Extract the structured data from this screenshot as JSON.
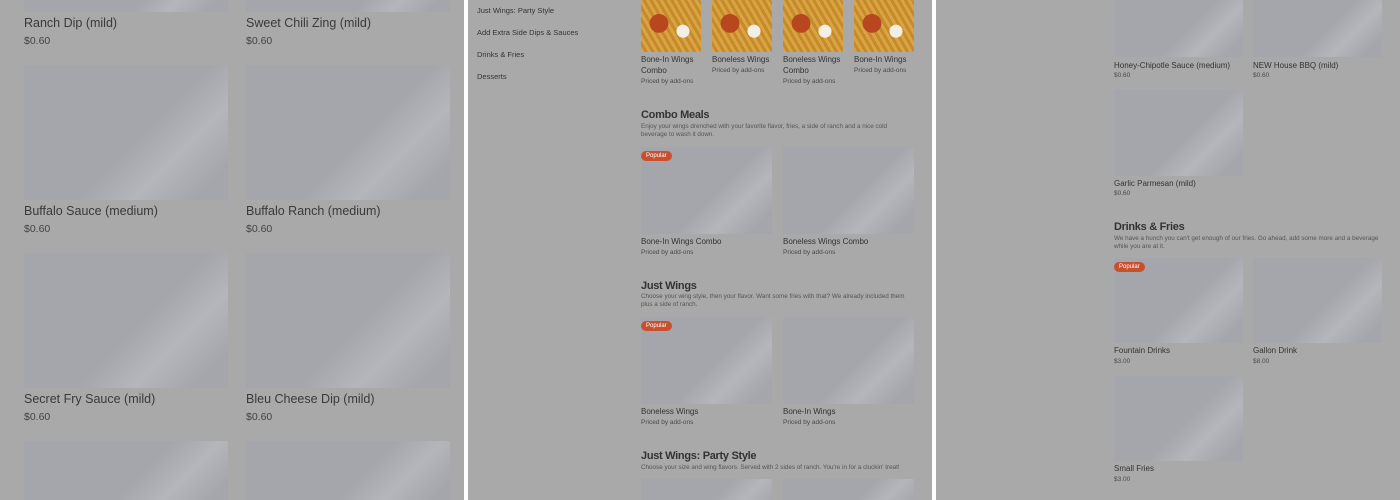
{
  "left": {
    "items": [
      {
        "name": "Ranch Dip (mild)",
        "price": "$0.60"
      },
      {
        "name": "Sweet Chili Zing (mild)",
        "price": "$0.60"
      },
      {
        "name": "Buffalo Sauce (medium)",
        "price": "$0.60"
      },
      {
        "name": "Buffalo Ranch (medium)",
        "price": "$0.60"
      },
      {
        "name": "Secret Fry Sauce (mild)",
        "price": "$0.60"
      },
      {
        "name": "Bleu Cheese Dip (mild)",
        "price": "$0.60"
      }
    ]
  },
  "middle": {
    "nav": [
      "Just Wings: Party Style",
      "Add Extra Side Dips & Sauces",
      "Drinks & Fries",
      "Desserts"
    ],
    "top_items": [
      {
        "name": "Bone-In Wings Combo",
        "price": "Priced by add-ons"
      },
      {
        "name": "Boneless Wings",
        "price": "Priced by add-ons"
      },
      {
        "name": "Boneless Wings Combo",
        "price": "Priced by add-ons"
      },
      {
        "name": "Bone-In Wings",
        "price": "Priced by add-ons"
      }
    ],
    "combo": {
      "title": "Combo Meals",
      "desc": "Enjoy your wings drenched with your favorite flavor, fries, a side of ranch and a nice cold beverage to wash it down.",
      "badge": "Popular",
      "items": [
        {
          "name": "Bone-In Wings Combo",
          "price": "Priced by add-ons"
        },
        {
          "name": "Boneless Wings Combo",
          "price": "Priced by add-ons"
        }
      ]
    },
    "just": {
      "title": "Just Wings",
      "desc": "Choose your wing style, then your flavor. Want some fries with that? We already included them plus a side of ranch.",
      "badge": "Popular",
      "items": [
        {
          "name": "Boneless Wings",
          "price": "Priced by add-ons"
        },
        {
          "name": "Bone-In Wings",
          "price": "Priced by add-ons"
        }
      ]
    },
    "party": {
      "title": "Just Wings: Party Style",
      "desc": "Choose your size and wing flavors. Served with 2 sides of ranch. You're in for a cluckin' treat!"
    }
  },
  "right": {
    "top_items": [
      {
        "name": "Honey-Chipotle Sauce (medium)",
        "price": "$0.60"
      },
      {
        "name": "NEW House BBQ (mild)",
        "price": "$0.60"
      }
    ],
    "garlic": {
      "name": "Garlic Parmesan (mild)",
      "price": "$0.60"
    },
    "drinks": {
      "title": "Drinks & Fries",
      "desc": "We have a hunch you can't get enough of our fries. Go ahead, add some more and a beverage while you are at it.",
      "badge": "Popular",
      "items": [
        {
          "name": "Fountain Drinks",
          "price": "$3.00"
        },
        {
          "name": "Gallon Drink",
          "price": "$8.00"
        }
      ],
      "fries": {
        "name": "Small Fries",
        "price": "$3.00"
      }
    }
  }
}
